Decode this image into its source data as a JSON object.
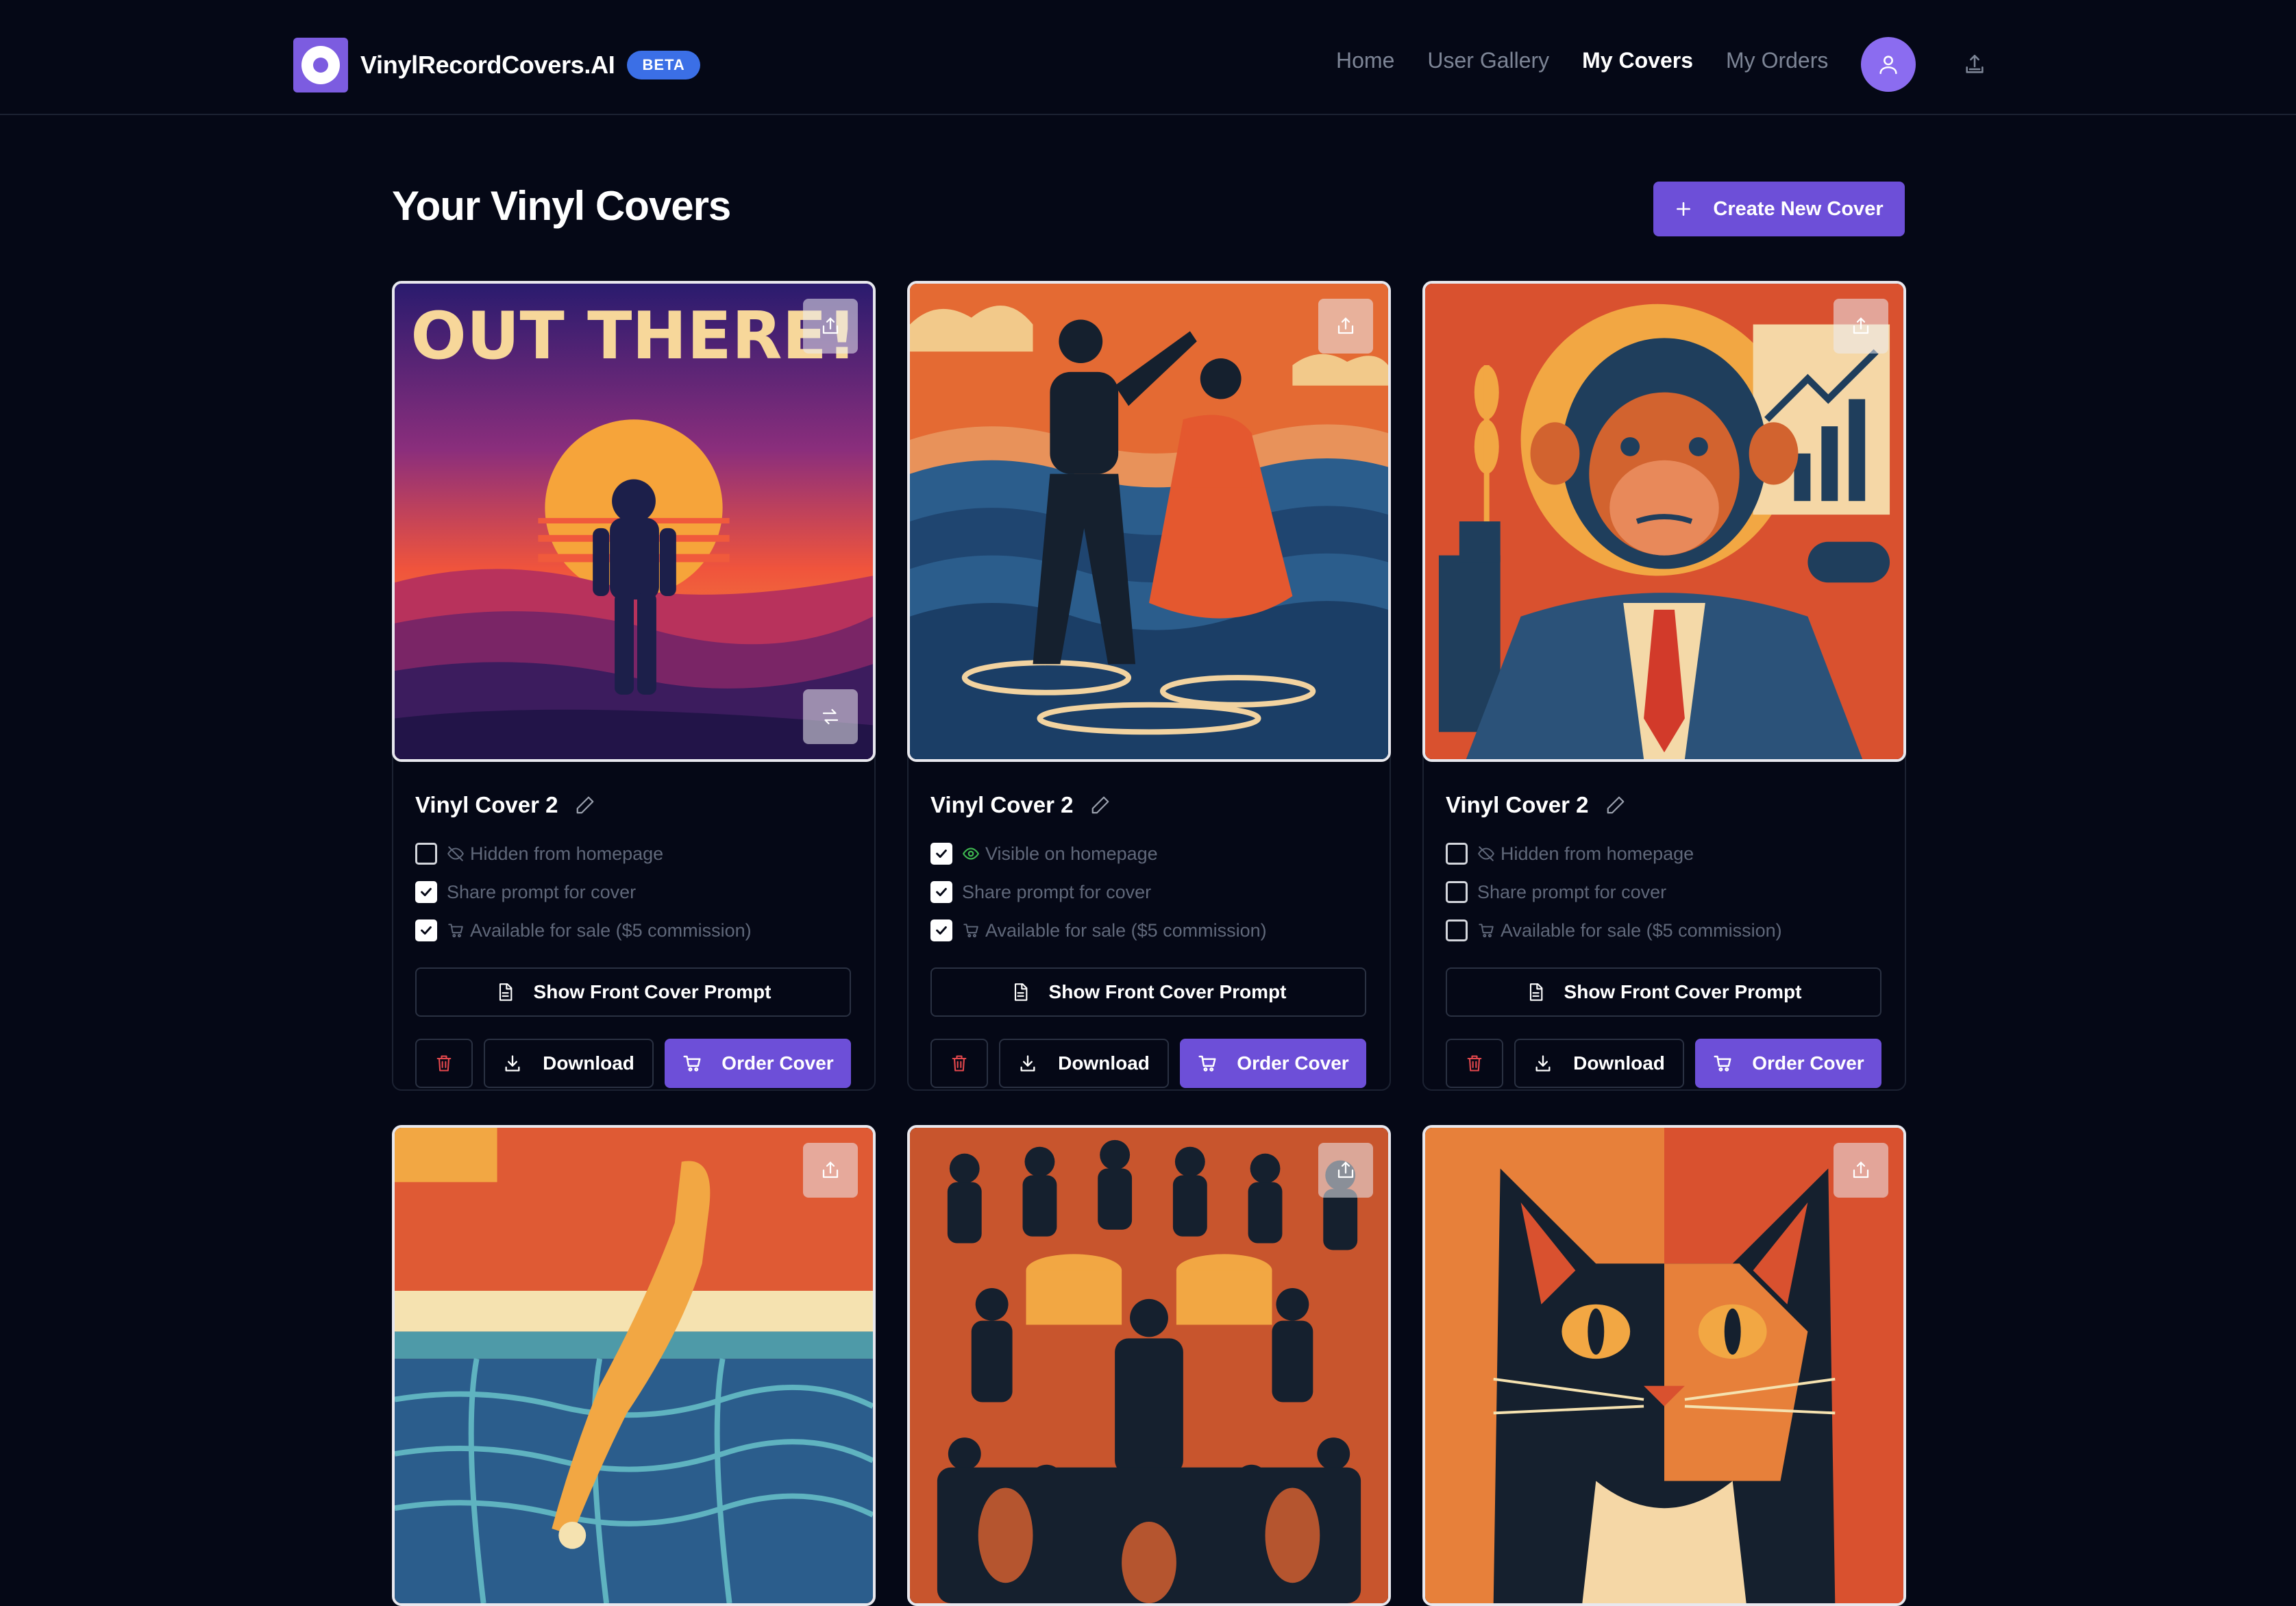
{
  "brand": {
    "name": "VinylRecordCovers.AI",
    "badge": "BETA"
  },
  "nav": {
    "home": "Home",
    "user_gallery": "User Gallery",
    "my_covers": "My Covers",
    "my_orders": "My Orders"
  },
  "page": {
    "title": "Your Vinyl Covers",
    "create_button": "Create New Cover"
  },
  "cover_text": "OUT THERE!",
  "labels": {
    "hidden": "Hidden from homepage",
    "visible": "Visible on homepage",
    "share_prompt": "Share prompt for cover",
    "for_sale": "Available for sale ($5 commission)",
    "show_prompt": "Show Front Cover Prompt",
    "download": "Download",
    "order": "Order Cover"
  },
  "cards": [
    {
      "title": "Vinyl Cover 2",
      "image": "astronaut-sunset",
      "visible_on_homepage": false,
      "share_prompt": true,
      "for_sale": true
    },
    {
      "title": "Vinyl Cover 2",
      "image": "couple-dancing-waves",
      "visible_on_homepage": true,
      "share_prompt": true,
      "for_sale": true
    },
    {
      "title": "Vinyl Cover 2",
      "image": "chimp-in-suit",
      "visible_on_homepage": false,
      "share_prompt": false,
      "for_sale": false
    },
    {
      "image": "cat-diving-pool"
    },
    {
      "image": "orchestra"
    },
    {
      "image": "cat-portrait"
    }
  ],
  "colors": {
    "accent": "#6d4fd8",
    "badge": "#3b6fe6",
    "background": "#050816",
    "delete": "#e5484d",
    "visible_eye": "#3fb950"
  }
}
